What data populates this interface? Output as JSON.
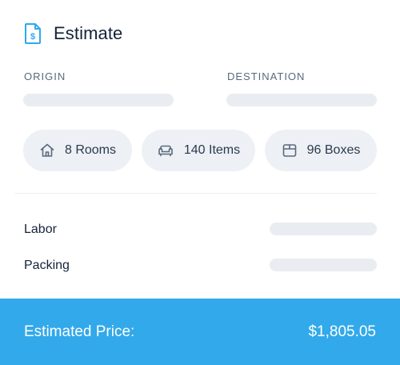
{
  "header": {
    "title": "Estimate",
    "icon": "invoice-dollar-icon"
  },
  "route": {
    "origin_label": "ORIGIN",
    "destination_label": "DESTINATION"
  },
  "summary": {
    "rooms": "8 Rooms",
    "items": "140 Items",
    "boxes": "96 Boxes"
  },
  "costs": {
    "labor_label": "Labor",
    "packing_label": "Packing"
  },
  "footer": {
    "label": "Estimated Price:",
    "price": "$1,805.05"
  },
  "colors": {
    "accent": "#32a9ea",
    "skeleton": "#e9edf2",
    "chip_bg": "#edf0f4"
  }
}
